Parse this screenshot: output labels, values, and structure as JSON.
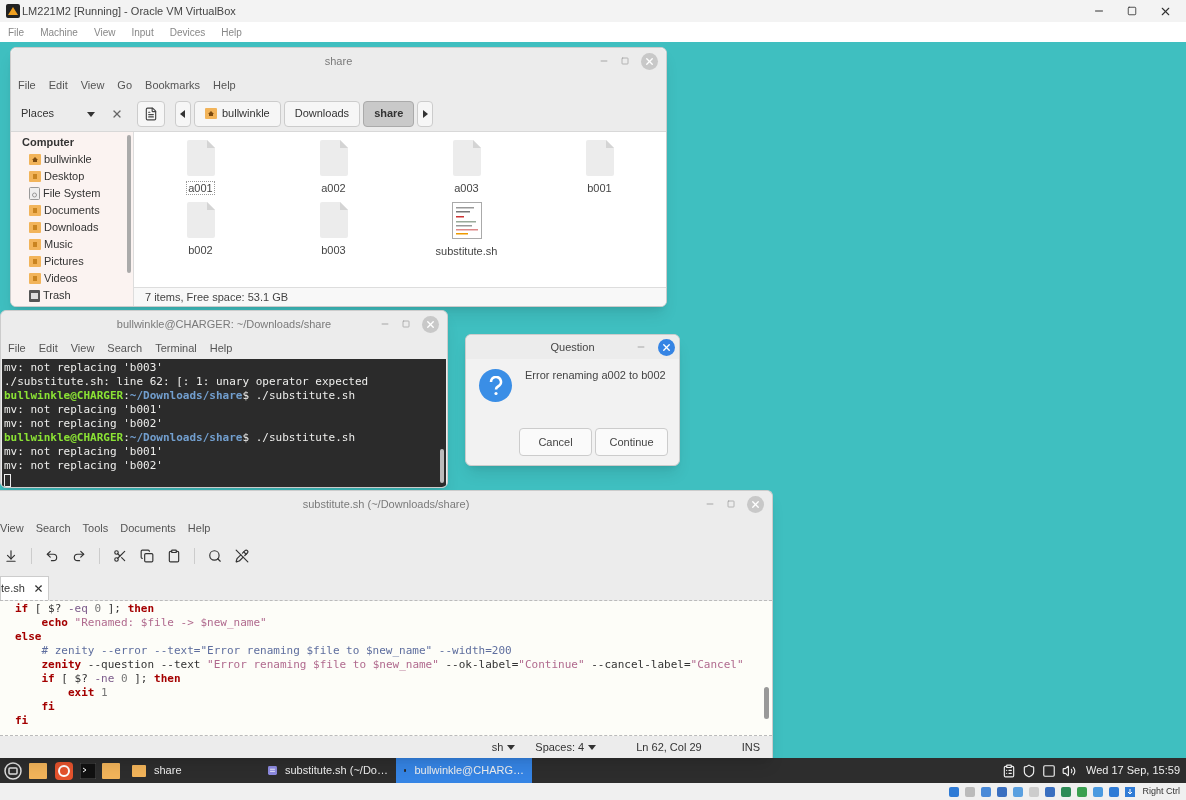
{
  "host_window": {
    "title": "LM221M2 [Running] - Oracle VM VirtualBox",
    "menu": [
      "File",
      "Machine",
      "View",
      "Input",
      "Devices",
      "Help"
    ],
    "status_text": "Right Ctrl"
  },
  "file_manager": {
    "title": "share",
    "menu": [
      "File",
      "Edit",
      "View",
      "Go",
      "Bookmarks",
      "Help"
    ],
    "places_label": "Places",
    "breadcrumbs": [
      {
        "label": "bullwinkle",
        "kind": "home",
        "selected": false
      },
      {
        "label": "Downloads",
        "kind": "plain",
        "selected": false
      },
      {
        "label": "share",
        "kind": "plain",
        "selected": true
      }
    ],
    "sidebar": {
      "heading": "Computer",
      "items": [
        {
          "label": "bullwinkle",
          "kind": "home"
        },
        {
          "label": "Desktop",
          "kind": "folder"
        },
        {
          "label": "File System",
          "kind": "drive"
        },
        {
          "label": "Documents",
          "kind": "folder"
        },
        {
          "label": "Downloads",
          "kind": "folder"
        },
        {
          "label": "Music",
          "kind": "folder"
        },
        {
          "label": "Pictures",
          "kind": "folder"
        },
        {
          "label": "Videos",
          "kind": "folder"
        },
        {
          "label": "Trash",
          "kind": "trash"
        }
      ]
    },
    "files": [
      {
        "name": "a001",
        "kind": "blank",
        "focused": true
      },
      {
        "name": "a002",
        "kind": "blank",
        "focused": false
      },
      {
        "name": "a003",
        "kind": "blank",
        "focused": false
      },
      {
        "name": "b001",
        "kind": "blank",
        "focused": false
      },
      {
        "name": "b002",
        "kind": "blank",
        "focused": false
      },
      {
        "name": "b003",
        "kind": "blank",
        "focused": false
      },
      {
        "name": "substitute.sh",
        "kind": "script",
        "focused": false
      }
    ],
    "status": "7 items, Free space: 53.1 GB"
  },
  "terminal": {
    "title": "bullwinkle@CHARGER: ~/Downloads/share",
    "menu": [
      "File",
      "Edit",
      "View",
      "Search",
      "Terminal",
      "Help"
    ],
    "lines": [
      [
        {
          "kind": "plain",
          "text": "mv: not replacing 'b003'"
        }
      ],
      [
        {
          "kind": "plain",
          "text": "./substitute.sh: line 62: [: 1: unary operator expected"
        }
      ],
      [
        {
          "kind": "user",
          "text": "bullwinkle@CHARGER"
        },
        {
          "kind": "plain",
          "text": ":"
        },
        {
          "kind": "path",
          "text": "~/Downloads/share"
        },
        {
          "kind": "plain",
          "text": "$ ./substitute.sh"
        }
      ],
      [
        {
          "kind": "plain",
          "text": "mv: not replacing 'b001'"
        }
      ],
      [
        {
          "kind": "plain",
          "text": "mv: not replacing 'b002'"
        }
      ],
      [
        {
          "kind": "user",
          "text": "bullwinkle@CHARGER"
        },
        {
          "kind": "plain",
          "text": ":"
        },
        {
          "kind": "path",
          "text": "~/Downloads/share"
        },
        {
          "kind": "plain",
          "text": "$ ./substitute.sh"
        }
      ],
      [
        {
          "kind": "plain",
          "text": "mv: not replacing 'b001'"
        }
      ],
      [
        {
          "kind": "plain",
          "text": "mv: not replacing 'b002'"
        }
      ]
    ]
  },
  "dialog": {
    "title": "Question",
    "message": "Error renaming a002 to b002",
    "buttons": [
      "Cancel",
      "Continue"
    ]
  },
  "editor": {
    "title": "substitute.sh (~/Downloads/share)",
    "menu": [
      "View",
      "Search",
      "Tools",
      "Documents",
      "Help"
    ],
    "tab": "te.sh",
    "lines": [
      {
        "tokens": [
          {
            "kind": "keyword",
            "text": "if"
          },
          {
            "kind": "plain",
            "text": " [ $? "
          },
          {
            "kind": "option",
            "text": "-eq"
          },
          {
            "kind": "number",
            "text": " 0"
          },
          {
            "kind": "plain",
            "text": " ]; "
          },
          {
            "kind": "keyword",
            "text": "then"
          }
        ],
        "children": [
          {
            "tokens": [
              {
                "kind": "keyword",
                "text": "echo"
              },
              {
                "kind": "string",
                "text": " \"Renamed: $file -> $new_name\""
              }
            ]
          }
        ]
      },
      {
        "tokens": [
          {
            "kind": "keyword",
            "text": "else"
          }
        ],
        "children": [
          {
            "tokens": [
              {
                "kind": "comment",
                "text": "# zenity --error --text=\"Error renaming $file to $new_name\" --width=200"
              }
            ]
          },
          {
            "tokens": [
              {
                "kind": "keyword",
                "text": "zenity"
              },
              {
                "kind": "plain",
                "text": " --question --text "
              },
              {
                "kind": "string",
                "text": "\"Error renaming $file to $new_name\""
              },
              {
                "kind": "plain",
                "text": " --ok-label="
              },
              {
                "kind": "string",
                "text": "\"Continue\""
              },
              {
                "kind": "plain",
                "text": " --cancel-label="
              },
              {
                "kind": "string",
                "text": "\"Cancel\""
              }
            ]
          },
          {
            "tokens": [
              {
                "kind": "keyword",
                "text": "if"
              },
              {
                "kind": "plain",
                "text": " [ $? "
              },
              {
                "kind": "option",
                "text": "-ne"
              },
              {
                "kind": "number",
                "text": " 0"
              },
              {
                "kind": "plain",
                "text": " ]; "
              },
              {
                "kind": "keyword",
                "text": "then"
              }
            ],
            "children": [
              {
                "tokens": [
                  {
                    "kind": "keyword",
                    "text": "exit"
                  },
                  {
                    "kind": "number",
                    "text": " 1"
                  }
                ]
              }
            ]
          },
          {
            "tokens": [
              {
                "kind": "keyword",
                "text": "fi"
              }
            ]
          }
        ]
      },
      {
        "tokens": [
          {
            "kind": "keyword",
            "text": "fi"
          }
        ]
      }
    ],
    "status": {
      "language": "sh",
      "spaces": "Spaces: 4",
      "position": "Ln 62, Col 29",
      "mode": "INS"
    }
  },
  "taskbar": {
    "tasks": [
      {
        "label": "share",
        "kind": "folder",
        "selected": false
      },
      {
        "label": "substitute.sh (~/Do…",
        "kind": "editor",
        "selected": false
      },
      {
        "label": "bullwinkle@CHARG…",
        "kind": "terminal",
        "selected": true
      }
    ],
    "clock": "Wed 17 Sep, 15:59"
  }
}
